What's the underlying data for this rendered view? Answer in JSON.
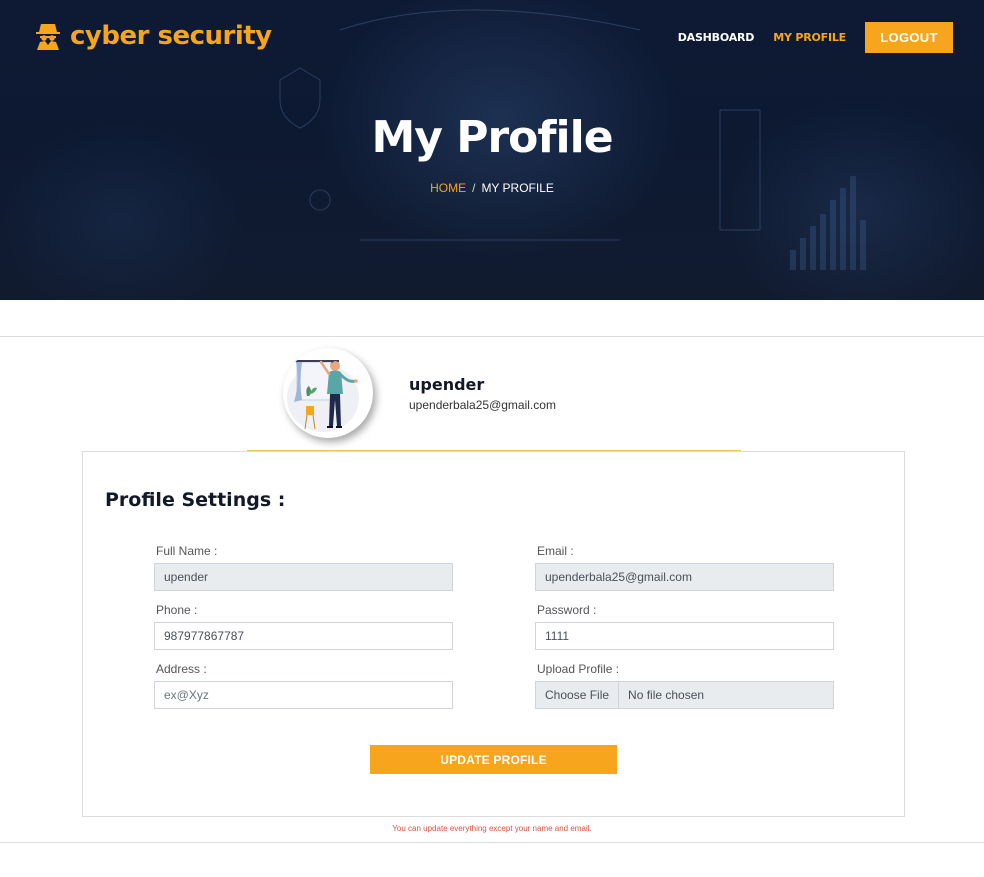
{
  "brand": {
    "name": "cyber security",
    "icon": "spy-agent-icon",
    "color": "#f7a51c"
  },
  "nav": {
    "items": [
      {
        "label": "DASHBOARD",
        "active": false
      },
      {
        "label": "MY PROFILE",
        "active": true
      }
    ],
    "logout_label": "LOGOUT"
  },
  "hero": {
    "title": "My Profile",
    "breadcrumb": {
      "home": "HOME",
      "separator": "/",
      "current": "MY PROFILE"
    }
  },
  "profile": {
    "name": "upender",
    "email": "upenderbala25@gmail.com",
    "avatar_icon": "person-at-window-illustration-icon"
  },
  "settings": {
    "title": "Profile Settings :",
    "fields": {
      "full_name": {
        "label": "Full Name :",
        "value": "upender",
        "readonly": true
      },
      "email": {
        "label": "Email :",
        "value": "upenderbala25@gmail.com",
        "readonly": true
      },
      "phone": {
        "label": "Phone :",
        "value": "987977867787"
      },
      "password": {
        "label": "Password :",
        "value": "1111"
      },
      "address": {
        "label": "Address :",
        "value": "",
        "placeholder": "ex@Xyz"
      },
      "upload": {
        "label": "Upload Profile :",
        "button": "Choose File",
        "status": "No file chosen"
      }
    },
    "submit_label": "UPDATE PROFILE",
    "note": "You can update everything except your name and email."
  },
  "colors": {
    "accent": "#f7a51c",
    "hero_bg": "#0e1a34",
    "note": "#e0533d"
  }
}
